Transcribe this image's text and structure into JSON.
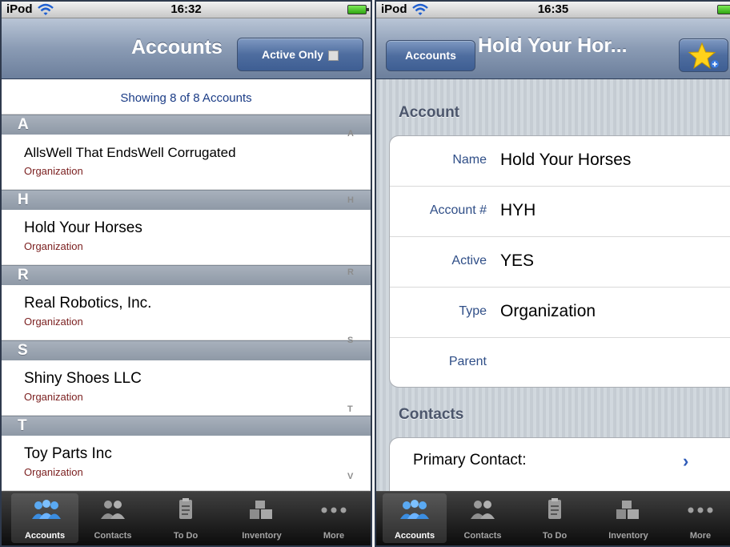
{
  "left": {
    "status": {
      "carrier": "iPod",
      "time": "16:32"
    },
    "nav": {
      "title": "Accounts",
      "active_only_label": "Active Only"
    },
    "showing_text": "Showing 8 of 8 Accounts",
    "sections": [
      {
        "letter": "A",
        "rows": [
          {
            "name": "AllsWell That EndsWell Corrugated",
            "type": "Organization"
          }
        ]
      },
      {
        "letter": "H",
        "rows": [
          {
            "name": "Hold Your Horses",
            "type": "Organization"
          }
        ]
      },
      {
        "letter": "R",
        "rows": [
          {
            "name": "Real Robotics, Inc.",
            "type": "Organization"
          }
        ]
      },
      {
        "letter": "S",
        "rows": [
          {
            "name": "Shiny Shoes LLC",
            "type": "Organization"
          }
        ]
      },
      {
        "letter": "T",
        "rows": [
          {
            "name": "Toy Parts Inc",
            "type": "Organization"
          }
        ]
      }
    ],
    "index": [
      "A",
      "H",
      "R",
      "S",
      "T",
      "V"
    ]
  },
  "right": {
    "status": {
      "carrier": "iPod",
      "time": "16:35"
    },
    "nav": {
      "back_label": "Accounts",
      "title": "Hold Your Hor..."
    },
    "account_heading": "Account",
    "fields": [
      {
        "label": "Name",
        "value": "Hold Your Horses"
      },
      {
        "label": "Account #",
        "value": "HYH"
      },
      {
        "label": "Active",
        "value": "YES"
      },
      {
        "label": "Type",
        "value": "Organization"
      },
      {
        "label": "Parent",
        "value": ""
      }
    ],
    "contacts_heading": "Contacts",
    "primary_contact_label": "Primary Contact:"
  },
  "tabs": [
    {
      "label": "Accounts",
      "icon": "accounts-icon"
    },
    {
      "label": "Contacts",
      "icon": "contacts-icon"
    },
    {
      "label": "To Do",
      "icon": "todo-icon"
    },
    {
      "label": "Inventory",
      "icon": "inventory-icon"
    },
    {
      "label": "More",
      "icon": "more-icon"
    }
  ],
  "colors": {
    "nav_bar": "#8a9bb4",
    "link_blue": "#1b3c86",
    "subtitle_red": "#7a1e1e",
    "tab_bar": "#262626"
  }
}
